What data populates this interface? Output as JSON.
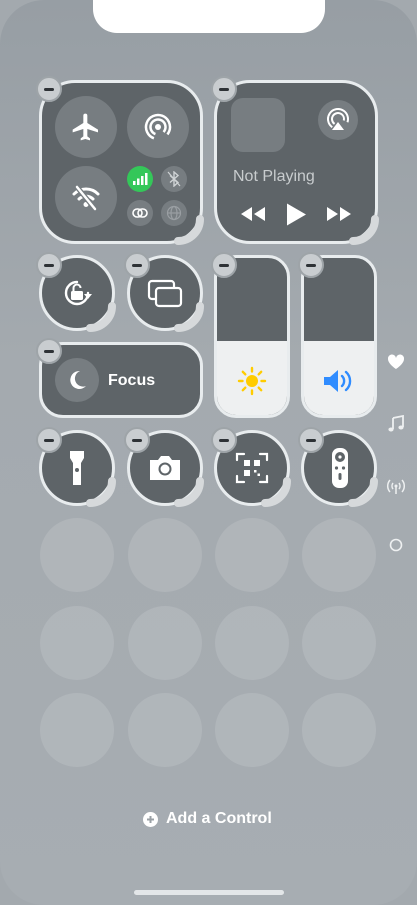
{
  "now_playing": {
    "status": "Not Playing"
  },
  "focus": {
    "label": "Focus"
  },
  "footer": {
    "add_control_label": "Add a Control"
  },
  "colors": {
    "tile_bg": "#5e6468",
    "tile_border": "#e8ecee",
    "cellular_active": "#34c759",
    "slider_fill": "#eef0f1",
    "brightness_icon": "#ffcc00",
    "volume_icon": "#2f8cff",
    "background": "#a3a9ae"
  },
  "icons": {
    "connectivity": [
      "airplane-icon",
      "airdrop-icon",
      "wifi-off-icon",
      "cellular-icon",
      "bluetooth-off-icon",
      "personal-hotspot-icon",
      "vpn-globe-icon"
    ],
    "media": [
      "airplay-icon",
      "rewind-icon",
      "play-icon",
      "forward-icon"
    ],
    "controls": [
      "orientation-lock-icon",
      "screen-mirroring-icon",
      "moon-icon",
      "sun-icon",
      "speaker-icon",
      "flashlight-icon",
      "camera-icon",
      "qr-code-icon",
      "apple-tv-remote-icon"
    ],
    "side_pages": [
      "heart-icon",
      "music-note-icon",
      "antenna-icon",
      "circle-icon"
    ]
  }
}
